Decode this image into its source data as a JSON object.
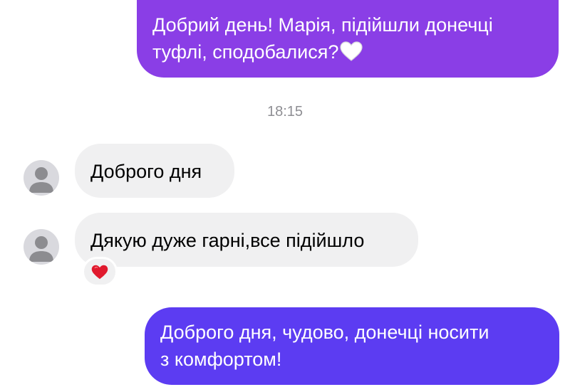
{
  "messages": {
    "out_1": {
      "line1": "Добрий день! Марія, підійшли донечці",
      "line2": "туфлі, сподобалися?",
      "emoji": "white-heart-icon"
    },
    "timestamp": "18:15",
    "in_1": "Доброго дня",
    "in_2": "Дякую дуже гарні,все підійшло",
    "reaction": "red-heart-icon",
    "out_2": {
      "line1": "Доброго дня, чудово, донечці носити",
      "line2": "з комфортом!"
    }
  },
  "colors": {
    "outgoing_bubble_1": "#8a3ee6",
    "outgoing_bubble_2": "#5c3cf2",
    "incoming_bubble": "#f0f0f1",
    "timestamp_text": "#8e8e93",
    "avatar_bg": "#d9d9de",
    "avatar_fg": "#8c8c90",
    "heart_red": "#e0192d"
  }
}
